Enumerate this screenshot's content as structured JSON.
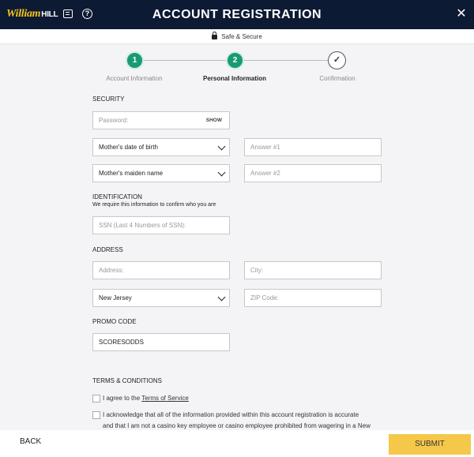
{
  "header": {
    "logo_text": "William",
    "logo_suffix": "HILL",
    "title": "ACCOUNT REGISTRATION"
  },
  "secure_bar": {
    "text": "Safe & Secure"
  },
  "stepper": {
    "steps": [
      {
        "number": "1",
        "label": "Account Information",
        "state": "done"
      },
      {
        "number": "2",
        "label": "Personal Information",
        "state": "current"
      },
      {
        "number": "✓",
        "label": "Confirmation",
        "state": "pending"
      }
    ]
  },
  "security": {
    "title": "SECURITY",
    "password_placeholder": "Password:",
    "show_label": "SHOW",
    "question1": "Mother's date of birth",
    "answer1_placeholder": "Answer #1",
    "question2": "Mother's maiden name",
    "answer2_placeholder": "Answer #2"
  },
  "identification": {
    "title": "IDENTIFICATION",
    "subtext": "We require this information to confirm who you are",
    "ssn_placeholder": "SSN (Last 4 Numbers of SSN):"
  },
  "address": {
    "title": "ADDRESS",
    "address_placeholder": "Address:",
    "city_placeholder": "City:",
    "state_value": "New Jersey",
    "zip_placeholder": "ZIP Code:"
  },
  "promo": {
    "title": "PROMO CODE",
    "code_value": "SCORESODDS"
  },
  "terms": {
    "title": "TERMS & CONDITIONS",
    "agree_prefix": "I agree to the ",
    "agree_link": "Terms of Service",
    "acknowledge_line1": "I acknowledge that all of the information provided within this account registration is accurate",
    "acknowledge_line2": "and that I am not a casino key employee or casino employee prohibited from wagering in a New"
  },
  "footer": {
    "back_label": "BACK",
    "submit_label": "SUBMIT"
  },
  "colors": {
    "header_bg": "#0c1a33",
    "brand_yellow": "#f5c518",
    "step_active": "#1a9a74",
    "submit_bg": "#f5c84a"
  }
}
